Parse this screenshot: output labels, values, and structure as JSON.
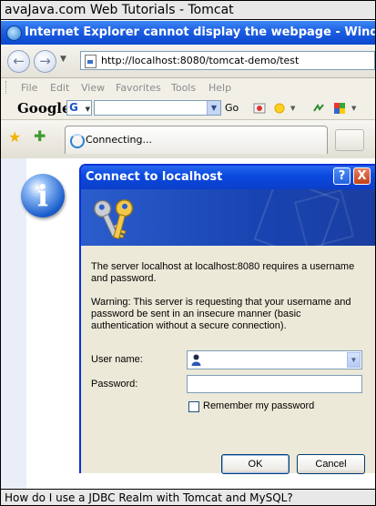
{
  "site_header": {
    "title": "avaJava.com Web Tutorials - Tomcat"
  },
  "browser": {
    "window_title": "Internet Explorer cannot display the webpage - Windows Intern",
    "address": "http://localhost:8080/tomcat-demo/test",
    "menu": [
      "File",
      "Edit",
      "View",
      "Favorites",
      "Tools",
      "Help"
    ],
    "google_label": "Google",
    "google_g": "G",
    "go_label": "Go",
    "tab_label": "Connecting..."
  },
  "dialog": {
    "title": "Connect to localhost",
    "help_label": "?",
    "close_label": "X",
    "message": "The server localhost at localhost:8080 requires a username and password.",
    "warning": "Warning: This server is requesting that your username and password be sent in an insecure manner (basic authentication without a secure connection).",
    "username_label": "User name:",
    "password_label": "Password:",
    "remember_label": "Remember my password",
    "ok_label": "OK",
    "cancel_label": "Cancel"
  },
  "caption": {
    "text": "How do I use a JDBC Realm with Tomcat and MySQL?"
  }
}
